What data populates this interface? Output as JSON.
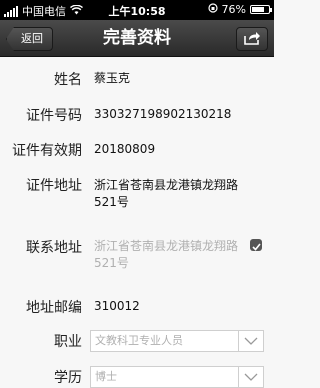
{
  "status_bar": {
    "carrier": "中国电信",
    "time": "上午10:58",
    "battery_percent": "76%",
    "battery_level": 0.76
  },
  "nav": {
    "back_label": "返回",
    "title": "完善资料",
    "share_icon": "share-icon"
  },
  "fields": {
    "name": {
      "label": "姓名",
      "value": "蔡玉克"
    },
    "id_number": {
      "label": "证件号码",
      "value": "330327198902130218"
    },
    "id_expiry": {
      "label": "证件有效期",
      "value": "20180809"
    },
    "id_address": {
      "label": "证件地址",
      "value_line1": "浙江省苍南县龙港镇龙翔路",
      "value_line2": "521号"
    },
    "contact_address": {
      "label": "联系地址",
      "value_line1": "浙江省苍南县龙港镇龙翔路",
      "value_line2": "521号",
      "same_checked": true
    },
    "postcode": {
      "label": "地址邮编",
      "value": "310012"
    },
    "occupation": {
      "label": "职业",
      "selected": "文教科卫专业人员"
    },
    "education": {
      "label": "学历",
      "selected": "博士"
    }
  },
  "colors": {
    "muted_text": "#b0b0b0",
    "nav_bg": "#333333"
  }
}
